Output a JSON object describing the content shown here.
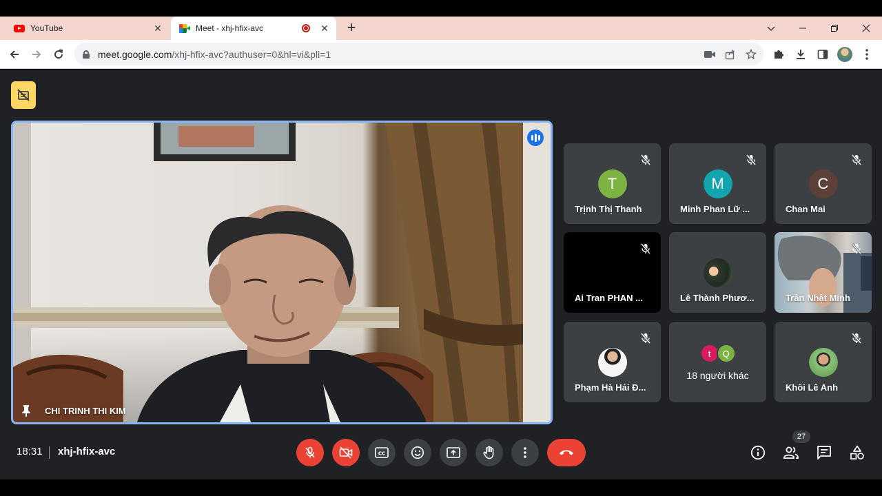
{
  "browser": {
    "tabs": [
      {
        "title": "YouTube",
        "icon": "youtube-icon",
        "active": false
      },
      {
        "title": "Meet - xhj-hfix-avc",
        "icon": "google-meet-icon",
        "active": true,
        "recording": true
      }
    ],
    "url_host": "meet.google.com",
    "url_path": "/xhj-hfix-avc?authuser=0&hl=vi&pli=1"
  },
  "meet": {
    "main_speaker": {
      "name": "CHI TRINH THI KIM",
      "pinned": true,
      "speaking": true
    },
    "participants": [
      {
        "name": "Trịnh Thị Thanh",
        "initial": "T",
        "color": "#7cb342",
        "muted": true
      },
      {
        "name": "Minh Phan Lữ ...",
        "initial": "M",
        "color": "#12a4af",
        "muted": true
      },
      {
        "name": "Chan Mai",
        "initial": "C",
        "color": "#5d4037",
        "muted": true
      },
      {
        "name": "Ai Tran PHAN ...",
        "muted": true,
        "video": "dark"
      },
      {
        "name": "Lê Thành Phươ...",
        "muted": false,
        "avatar": "photo"
      },
      {
        "name": "Trần Nhật Minh",
        "muted": true,
        "video": "camera"
      },
      {
        "name": "Phạm Hà Hải Đ...",
        "muted": true,
        "avatar": "photo"
      },
      {
        "name": "Khôi Lê Anh",
        "muted": true,
        "avatar": "photo"
      }
    ],
    "others": {
      "label": "18 người khác",
      "avatars": [
        {
          "initial": "t",
          "color": "#d81b60"
        },
        {
          "initial": "Q",
          "color": "#7cb342"
        }
      ]
    },
    "clock": "18:31",
    "meeting_code": "xhj-hfix-avc",
    "participant_count": "27"
  },
  "colors": {
    "accent_blue": "#8ab4f8",
    "danger_red": "#ea4335",
    "surface": "#3c4043",
    "background": "#202124",
    "tabbar": "#f5d6cf"
  }
}
